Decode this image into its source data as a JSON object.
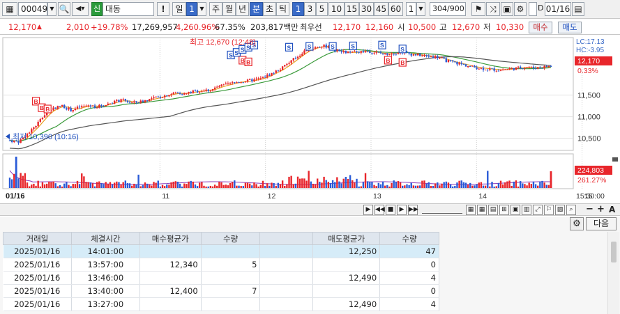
{
  "toolbar": {
    "code": "000490",
    "market_badge": "신",
    "stock_name": "대동",
    "alert": "!",
    "period_day": "일",
    "period_day_count": "1",
    "period_week": "주",
    "period_month": "월",
    "period_year": "년",
    "period_minute": "분",
    "period_second": "초",
    "period_tick": "틱",
    "intervals": [
      "1",
      "3",
      "5",
      "10",
      "15",
      "30",
      "45",
      "60"
    ],
    "interval_value": "1",
    "count": "304",
    "count_total": "/900",
    "date": "01/16",
    "date_prefix": "D"
  },
  "quote": {
    "price": "12,170",
    "change": "2,010",
    "change_pct": "+19.78%",
    "volume": "17,269,957",
    "volume_pct": "4,260.96%",
    "ratio": "67.35%",
    "amount": "203,817백만",
    "best_label": "최우선",
    "best_ask": "12,170",
    "best_bid": "12,160",
    "open_label": "시",
    "open": "10,500",
    "high_label": "고",
    "high": "12,670",
    "low_label": "저",
    "low": "10,330",
    "buy_btn": "매수",
    "sell_btn": "매도"
  },
  "chart_data": {
    "type": "candlestick",
    "title": "",
    "date_label": "01/16",
    "x_ticks": [
      "11",
      "12",
      "13",
      "14",
      "15"
    ],
    "y_ticks": [
      11500,
      11000,
      10500
    ],
    "ylim": [
      10300,
      12750
    ],
    "high_annotation": "최고 12,670 (12:48)",
    "low_annotation": "최저 10,390 (10:16)",
    "lc_label": "LC:17.13",
    "hc_label": "HC:-3.95",
    "last_price_tag": "12,170",
    "last_pct_tag": "0.33%",
    "volume_tag": "224,803",
    "volume_pct_tag": "261.27%",
    "time_label": "15:30:00",
    "ma_colors": [
      "#e8a020",
      "#3a9a3a",
      "#555555"
    ],
    "up_color": "#e8262b",
    "down_color": "#2a5bd7",
    "price_path": [
      [
        0,
        10450
      ],
      [
        3,
        10420
      ],
      [
        6,
        10600
      ],
      [
        9,
        10800
      ],
      [
        12,
        11050
      ],
      [
        15,
        11200
      ],
      [
        18,
        11250
      ],
      [
        21,
        11150
      ],
      [
        24,
        11220
      ],
      [
        27,
        11260
      ],
      [
        30,
        11230
      ],
      [
        33,
        11280
      ],
      [
        36,
        11350
      ],
      [
        39,
        11380
      ],
      [
        42,
        11320
      ],
      [
        45,
        11350
      ],
      [
        48,
        11400
      ],
      [
        51,
        11450
      ],
      [
        54,
        11500
      ],
      [
        57,
        11550
      ],
      [
        60,
        11530
      ],
      [
        63,
        11580
      ],
      [
        66,
        11600
      ],
      [
        69,
        11620
      ],
      [
        72,
        11700
      ],
      [
        75,
        11750
      ],
      [
        78,
        11800
      ],
      [
        81,
        11820
      ],
      [
        84,
        11850
      ],
      [
        87,
        11900
      ],
      [
        90,
        12000
      ],
      [
        93,
        12100
      ],
      [
        96,
        12250
      ],
      [
        99,
        12400
      ],
      [
        102,
        12550
      ],
      [
        105,
        12600
      ],
      [
        108,
        12650
      ],
      [
        111,
        12550
      ],
      [
        114,
        12500
      ],
      [
        117,
        12480
      ],
      [
        120,
        12500
      ],
      [
        123,
        12520
      ],
      [
        126,
        12480
      ],
      [
        129,
        12450
      ],
      [
        132,
        12480
      ],
      [
        135,
        12500
      ],
      [
        138,
        12450
      ],
      [
        141,
        12420
      ],
      [
        144,
        12400
      ],
      [
        147,
        12380
      ],
      [
        150,
        12300
      ],
      [
        153,
        12250
      ],
      [
        156,
        12200
      ],
      [
        159,
        12150
      ],
      [
        162,
        12120
      ],
      [
        165,
        12100
      ],
      [
        168,
        12080
      ],
      [
        171,
        12100
      ],
      [
        174,
        12120
      ],
      [
        177,
        12150
      ],
      [
        180,
        12130
      ],
      [
        183,
        12150
      ],
      [
        186,
        12170
      ]
    ],
    "buy_markers": [
      [
        9,
        11350
      ],
      [
        11,
        11200
      ],
      [
        13,
        11170
      ],
      [
        80,
        12300
      ],
      [
        82,
        12260
      ],
      [
        130,
        12300
      ],
      [
        135,
        12250
      ]
    ],
    "sell_markers": [
      [
        76,
        12420
      ],
      [
        78,
        12480
      ],
      [
        80,
        12550
      ],
      [
        82,
        12600
      ],
      [
        84,
        12650
      ],
      [
        96,
        12600
      ],
      [
        103,
        12620
      ],
      [
        111,
        12620
      ],
      [
        118,
        12630
      ],
      [
        128,
        12650
      ],
      [
        135,
        12560
      ]
    ]
  },
  "ctrl": {
    "zoom_out": "−",
    "zoom_in": "+",
    "auto": "A"
  },
  "panel": {
    "gear_icon_label": "⚙",
    "next_label": "다음",
    "headers": [
      "거래일",
      "체결시간",
      "매수평균가",
      "수량",
      "",
      "매도평균가",
      "수량"
    ],
    "rows": [
      [
        "2025/01/16",
        "14:01:00",
        "",
        "",
        "",
        "12,250",
        "47"
      ],
      [
        "2025/01/16",
        "13:57:00",
        "12,340",
        "5",
        "",
        "",
        "0"
      ],
      [
        "2025/01/16",
        "13:46:00",
        "",
        "",
        "",
        "12,490",
        "4"
      ],
      [
        "2025/01/16",
        "13:40:00",
        "12,400",
        "7",
        "",
        "",
        "0"
      ],
      [
        "2025/01/16",
        "13:27:00",
        "",
        "",
        "",
        "12,490",
        "4"
      ]
    ]
  }
}
